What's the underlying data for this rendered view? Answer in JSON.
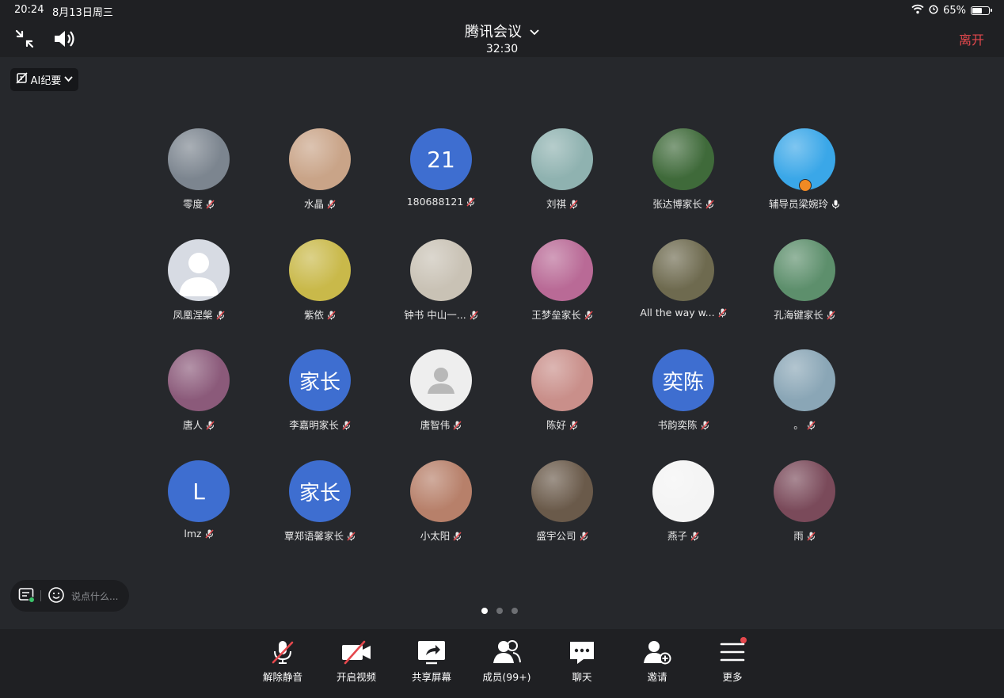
{
  "status_bar": {
    "time": "20:24",
    "date": "8月13日周三",
    "battery": "65%",
    "battery_level": 0.65
  },
  "header": {
    "title": "腾讯会议",
    "timer": "32:30",
    "leave_label": "离开"
  },
  "ai_summary": {
    "label": "AI纪要"
  },
  "participants": [
    {
      "name": "零度",
      "avatar": "photo",
      "color": "#7c858f",
      "muted": true
    },
    {
      "name": "水晶",
      "avatar": "photo",
      "color": "#c9a488",
      "muted": true
    },
    {
      "name": "180688121",
      "avatar": "text",
      "avatar_text": "21",
      "color": "#3e6ed0",
      "muted": true
    },
    {
      "name": "刘祺",
      "avatar": "photo",
      "color": "#8fb2b0",
      "muted": true
    },
    {
      "name": "张达博家长",
      "avatar": "photo",
      "color": "#3f6a3a",
      "muted": true
    },
    {
      "name": "辅导员梁婉玲",
      "avatar": "photo",
      "color": "#3aa7e8",
      "muted": false,
      "host": true
    },
    {
      "name": "凤凰涅槃",
      "avatar": "default",
      "color": "#d7dbe3",
      "muted": true
    },
    {
      "name": "紫依",
      "avatar": "photo",
      "color": "#c9b94a",
      "muted": true
    },
    {
      "name": "钟书 中山一...",
      "avatar": "photo",
      "color": "#c9c2b5",
      "muted": true
    },
    {
      "name": "王梦垒家长",
      "avatar": "photo",
      "color": "#b96a96",
      "muted": true
    },
    {
      "name": "All the way w...",
      "avatar": "photo",
      "color": "#6e6a4f",
      "muted": true
    },
    {
      "name": "孔海键家长",
      "avatar": "photo",
      "color": "#5d8f6c",
      "muted": true
    },
    {
      "name": "唐人",
      "avatar": "photo",
      "color": "#8b5a7a",
      "muted": true
    },
    {
      "name": "李嘉明家长",
      "avatar": "text",
      "avatar_text": "家长",
      "color": "#3e6ed0",
      "muted": true
    },
    {
      "name": "唐智伟",
      "avatar": "person",
      "color": "#eeeeee",
      "muted": true
    },
    {
      "name": "陈好",
      "avatar": "photo",
      "color": "#c98f8a",
      "muted": true
    },
    {
      "name": "书韵奕陈",
      "avatar": "text",
      "avatar_text": "奕陈",
      "color": "#3e6ed0",
      "muted": true
    },
    {
      "name": "。",
      "avatar": "photo",
      "color": "#8aa6b6",
      "muted": true
    },
    {
      "name": "lmz",
      "avatar": "text",
      "avatar_text": "L",
      "color": "#3e6ed0",
      "muted": true
    },
    {
      "name": "覃郑语馨家长",
      "avatar": "text",
      "avatar_text": "家长",
      "color": "#3e6ed0",
      "muted": true
    },
    {
      "name": "小太阳",
      "avatar": "photo",
      "color": "#b7806a",
      "muted": true
    },
    {
      "name": "盛宇公司",
      "avatar": "photo",
      "color": "#6a5a4a",
      "muted": true
    },
    {
      "name": "燕子",
      "avatar": "photo",
      "color": "#f4f4f4",
      "muted": true
    },
    {
      "name": "雨",
      "avatar": "photo",
      "color": "#7a4a5a",
      "muted": true
    }
  ],
  "chat_input": {
    "placeholder": "说点什么..."
  },
  "pagination": {
    "pages": 3,
    "current": 1
  },
  "toolbar": {
    "unmute": "解除静音",
    "video": "开启视频",
    "share": "共享屏幕",
    "members": "成员(99+)",
    "chat": "聊天",
    "invite": "邀请",
    "more": "更多"
  },
  "colors": {
    "background": "#26282c",
    "bar": "#1f2023",
    "accent_blue": "#3e6ed0",
    "danger": "#e5484d",
    "host_badge": "#f08a24"
  }
}
